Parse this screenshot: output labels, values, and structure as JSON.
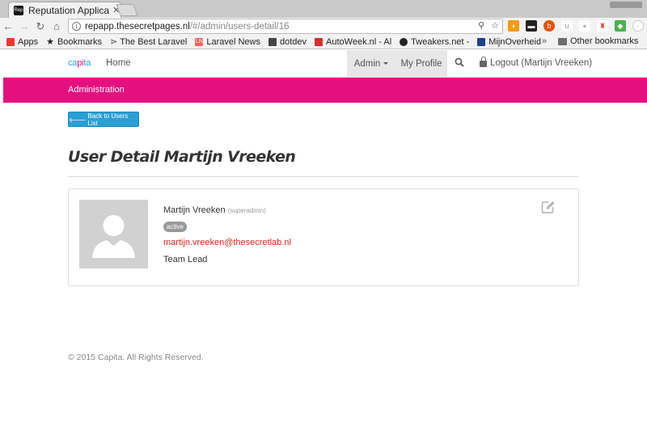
{
  "browser": {
    "tab_title": "Reputation Applica",
    "favicon_text": "Rep",
    "url_host": "repapp.thesecretpages.nl",
    "url_path": "/#/admin/users-detail/16",
    "bookmarks": [
      {
        "label": "Apps",
        "icon": "apps-grid-icon",
        "color": "#e53935"
      },
      {
        "label": "Bookmarks",
        "icon": "star-icon",
        "color": "#333333"
      },
      {
        "label": "The Best Laravel",
        "icon": "laravel-icon",
        "color": "#555555"
      },
      {
        "label": "Laravel News",
        "icon": "ln-icon",
        "color": "#f4645f"
      },
      {
        "label": "dotdev",
        "icon": "dotdev-icon",
        "color": "#444444"
      },
      {
        "label": "AutoWeek.nl - Al",
        "icon": "autoweek-icon",
        "color": "#d32f2f"
      },
      {
        "label": "Tweakers.net - ",
        "icon": "tweakers-icon",
        "color": "#222222"
      },
      {
        "label": "MijnOverheid",
        "icon": "mijnoverheid-icon",
        "color": "#1e3f8c"
      }
    ],
    "bookmarks_more": "»",
    "other_bookmarks": "Other bookmarks"
  },
  "navbar": {
    "brand_pre": "ca",
    "brand_pi": "pi",
    "brand_post": "ta",
    "home": "Home",
    "admin": "Admin",
    "profile": "My Profile",
    "logout": "Logout (Martijn Vreeken)"
  },
  "subnav": {
    "title": "Administration"
  },
  "page": {
    "back_button": "Back to Users List",
    "title": "User Detail Martijn Vreeken"
  },
  "user": {
    "name": "Martijn Vreeken",
    "role": "(superadmin)",
    "status": "active",
    "email": "martijn.vreeken@thesecretlab.nl",
    "job_title": "Team Lead"
  },
  "footer": {
    "copyright": "© 2015 Capita. All Rights Reserved."
  },
  "colors": {
    "accent_pink": "#e5107f",
    "primary_blue": "#2a9fd6",
    "email_red": "#d9261c"
  }
}
